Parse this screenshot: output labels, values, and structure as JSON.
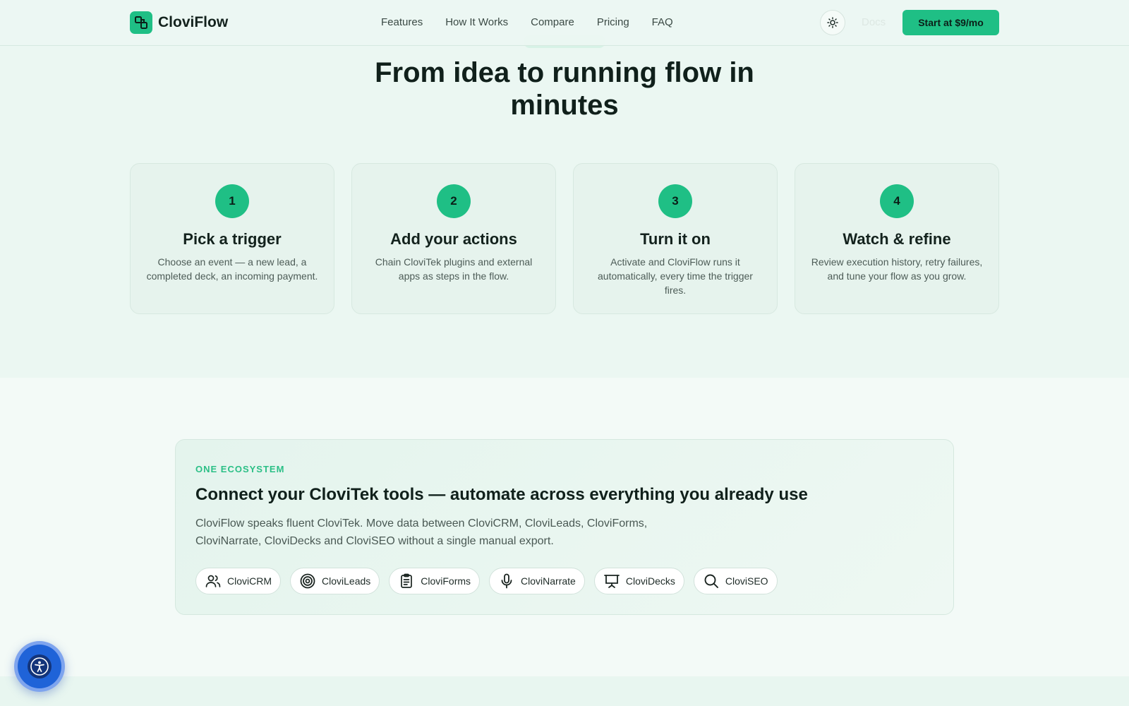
{
  "header": {
    "brand_name": "CloviFlow",
    "nav": [
      "Features",
      "How It Works",
      "Compare",
      "Pricing",
      "FAQ"
    ],
    "docs_label": "Docs",
    "cta_label": "Start at $9/mo"
  },
  "hero": {
    "title": "From idea to running flow in minutes"
  },
  "steps": [
    {
      "number": "1",
      "title": "Pick a trigger",
      "description": "Choose an event — a new lead, a completed deck, an incoming payment."
    },
    {
      "number": "2",
      "title": "Add your actions",
      "description": "Chain CloviTek plugins and external apps as steps in the flow."
    },
    {
      "number": "3",
      "title": "Turn it on",
      "description": "Activate and CloviFlow runs it automatically, every time the trigger fires."
    },
    {
      "number": "4",
      "title": "Watch & refine",
      "description": "Review execution history, retry failures, and tune your flow as you grow."
    }
  ],
  "ecosystem": {
    "eyebrow": "ONE ECOSYSTEM",
    "title": "Connect your CloviTek tools — automate across everything you already use",
    "description": "CloviFlow speaks fluent CloviTek. Move data between CloviCRM, CloviLeads, CloviForms, CloviNarrate, CloviDecks and CloviSEO without a single manual export.",
    "tools": [
      {
        "label": "CloviCRM",
        "icon": "users-icon"
      },
      {
        "label": "CloviLeads",
        "icon": "target-icon"
      },
      {
        "label": "CloviForms",
        "icon": "clipboard-icon"
      },
      {
        "label": "CloviNarrate",
        "icon": "microphone-icon"
      },
      {
        "label": "CloviDecks",
        "icon": "presentation-icon"
      },
      {
        "label": "CloviSEO",
        "icon": "search-icon"
      }
    ]
  },
  "colors": {
    "accent": "#1fbf85",
    "accessibility": "#1f63d8"
  }
}
